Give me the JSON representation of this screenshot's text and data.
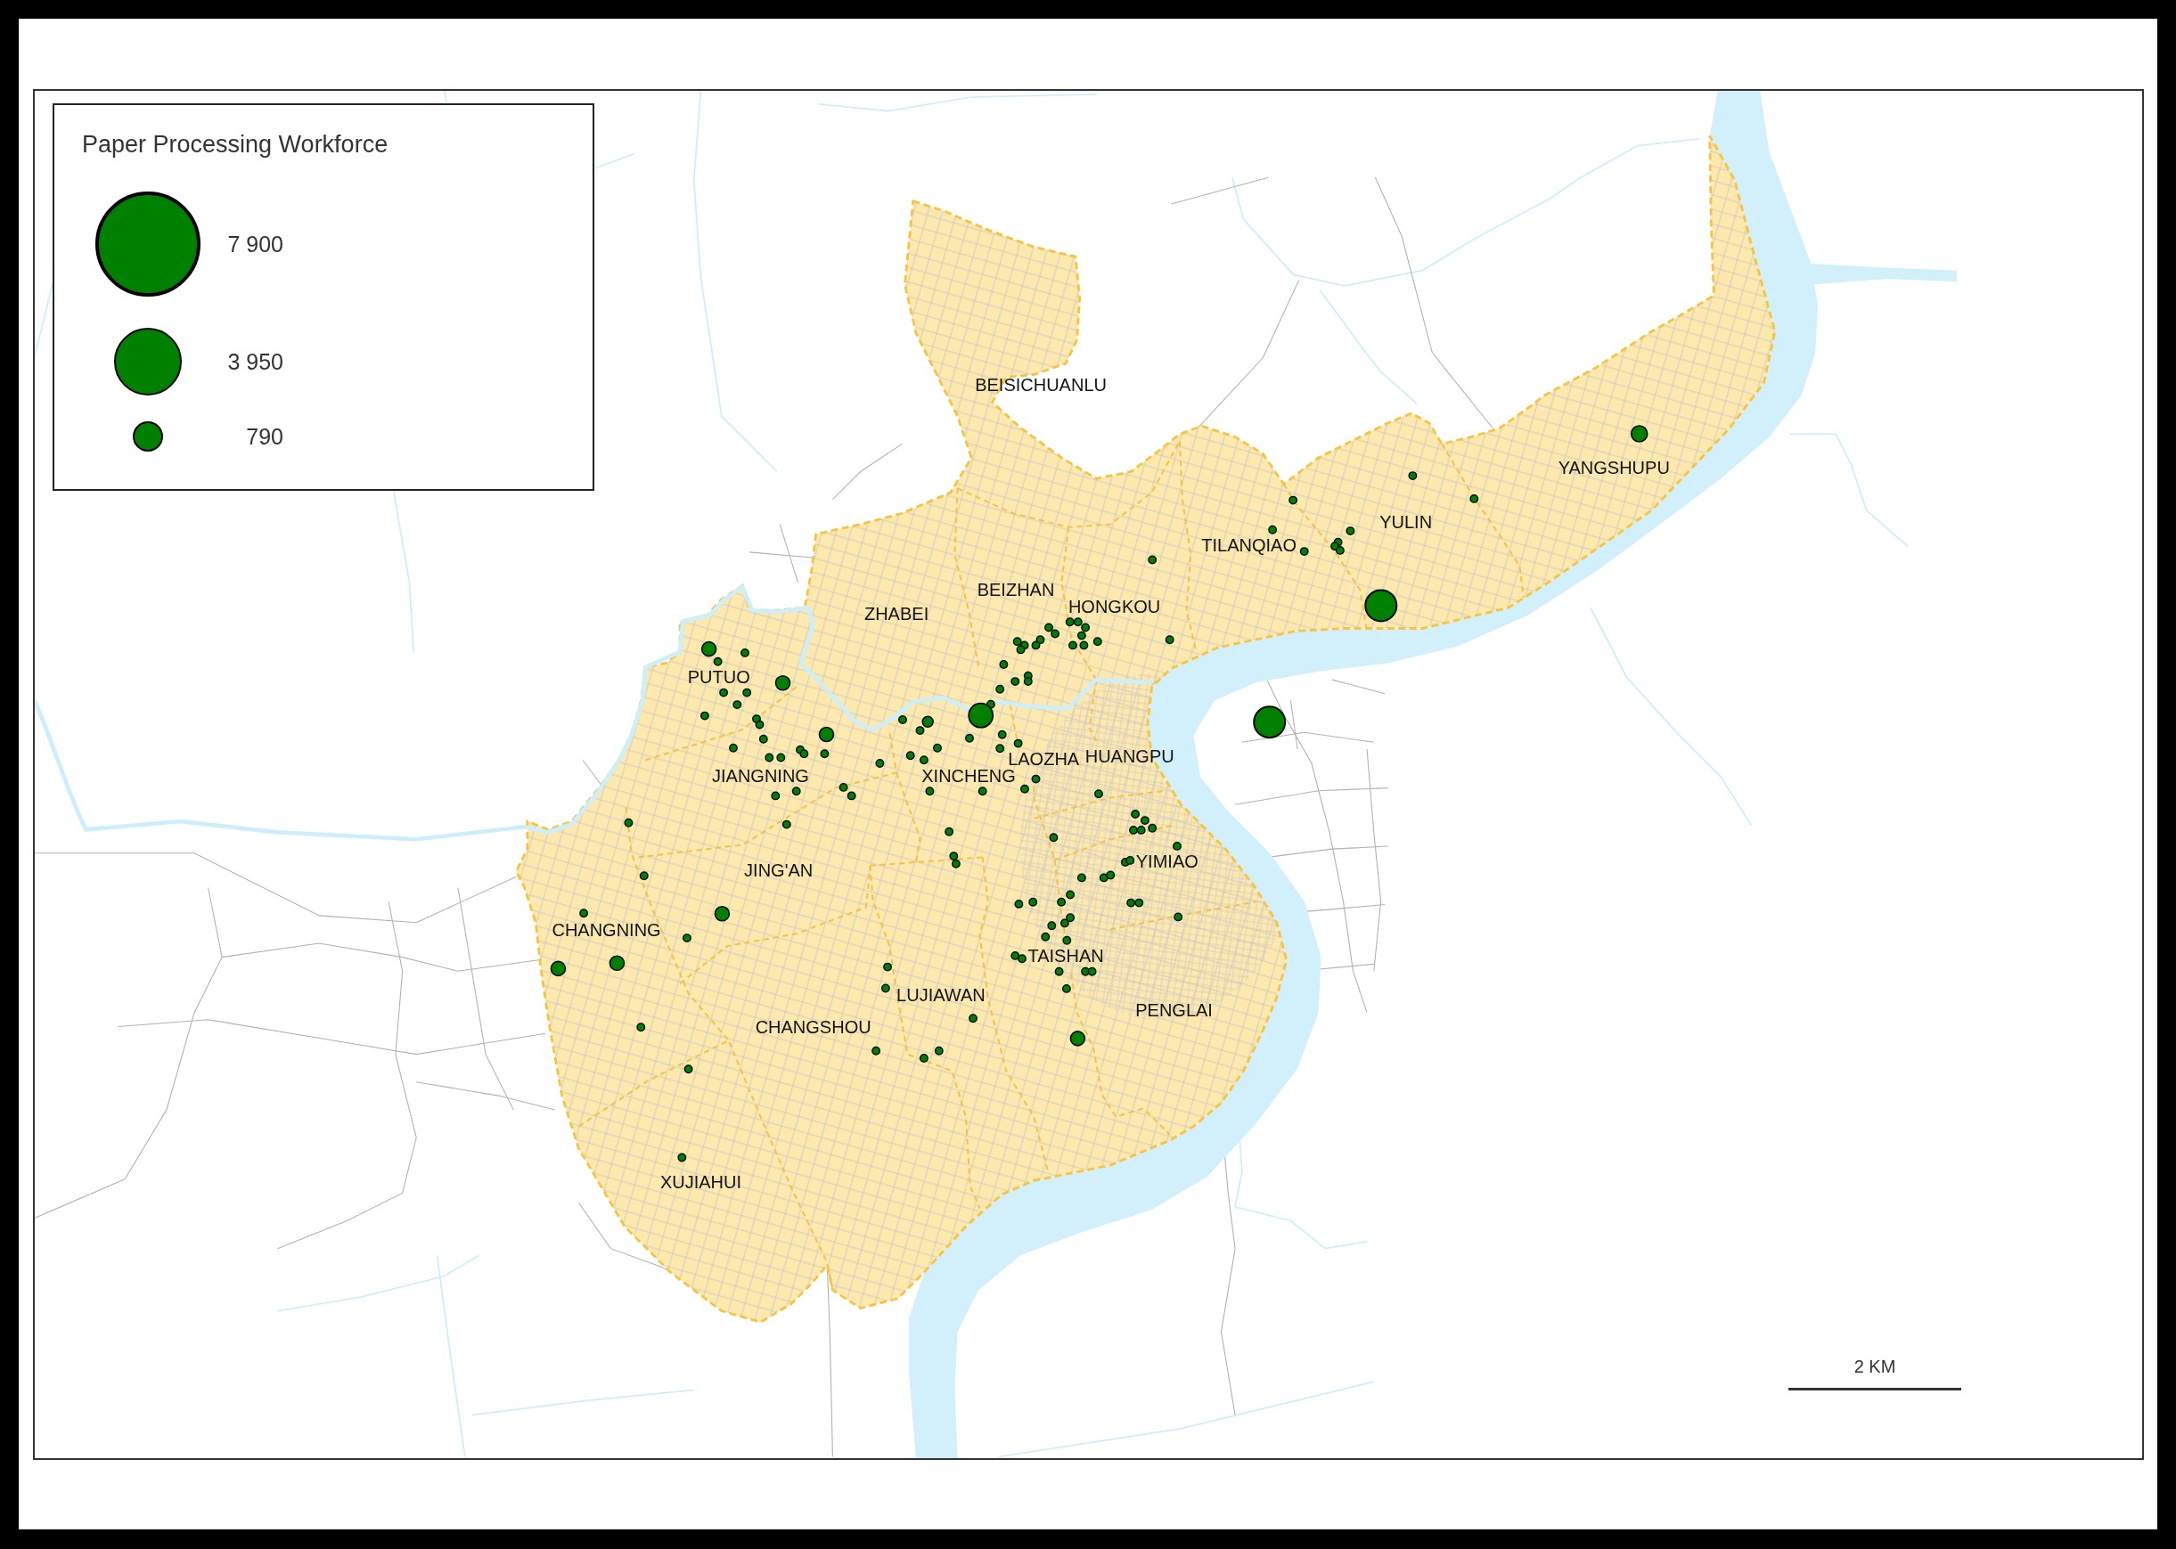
{
  "legend": {
    "title": "Paper Processing Workforce",
    "entries": [
      {
        "value": "7 900"
      },
      {
        "value": "3 950"
      },
      {
        "value": "790"
      }
    ]
  },
  "map": {
    "district_labels": [
      {
        "name": "BEISICHUANLU"
      },
      {
        "name": "YANGSHUPU"
      },
      {
        "name": "YULIN"
      },
      {
        "name": "TILANQIAO"
      },
      {
        "name": "BEIZHAN"
      },
      {
        "name": "HONGKOU"
      },
      {
        "name": "ZHABEI"
      },
      {
        "name": "PUTUO"
      },
      {
        "name": "HUANGPU"
      },
      {
        "name": "LAOZHA"
      },
      {
        "name": "JIANGNING"
      },
      {
        "name": "XINCHENG"
      },
      {
        "name": "YIMIAO"
      },
      {
        "name": "JING'AN"
      },
      {
        "name": "CHANGNING"
      },
      {
        "name": "TAISHAN"
      },
      {
        "name": "LUJIAWAN"
      },
      {
        "name": "PENGLAI"
      },
      {
        "name": "CHANGSHOU"
      },
      {
        "name": "XUJIAHUI"
      }
    ]
  },
  "scale_bar": {
    "label": "2 KM"
  }
}
